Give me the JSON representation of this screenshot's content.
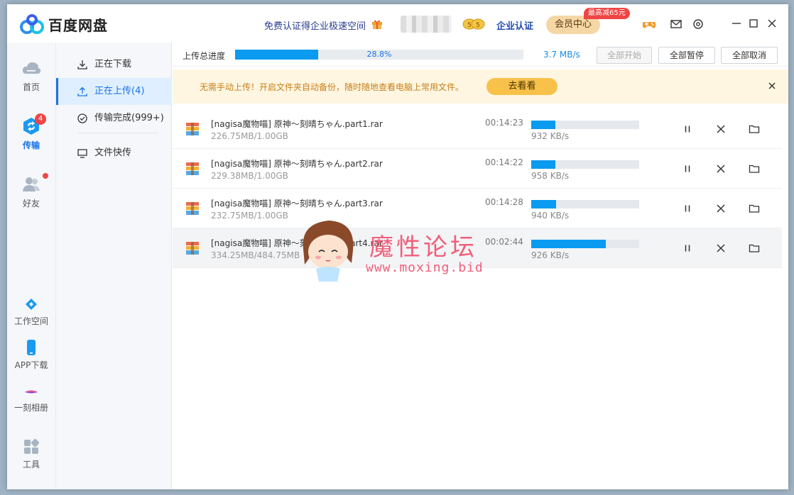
{
  "app": {
    "title": "百度网盘",
    "promo_text": "免费认证得企业极速空间",
    "enterprise_label": "企业认证",
    "vip_label": "会员中心",
    "vip_badge": "最高减65元",
    "coin_label": "5 5"
  },
  "leftnav": {
    "items": [
      {
        "label": "首页"
      },
      {
        "label": "传输",
        "badge": "4"
      },
      {
        "label": "好友"
      },
      {
        "label": "工作空间"
      },
      {
        "label": "APP下载"
      },
      {
        "label": "一刻相册"
      },
      {
        "label": "工具"
      }
    ]
  },
  "subnav": {
    "items": [
      {
        "label": "正在下载"
      },
      {
        "label": "正在上传(4)"
      },
      {
        "label": "传输完成(999+)"
      },
      {
        "label": "文件快传"
      }
    ]
  },
  "upload": {
    "total_label": "上传总进度",
    "total_percent_text": "28.8%",
    "total_progress": 0.288,
    "total_speed": "3.7 MB/s",
    "btn_start_all": "全部开始",
    "btn_pause_all": "全部暂停",
    "btn_cancel_all": "全部取消"
  },
  "banner": {
    "text": "无需手动上传！开启文件夹自动备份，随时随地查看电脑上常用文件。",
    "button": "去看看"
  },
  "files": [
    {
      "name": "[nagisa魔物喵] 原神～刻晴ちゃん.part1.rar",
      "size": "226.75MB/1.00GB",
      "time": "00:14:23",
      "speed": "932 KB/s",
      "progress": 0.2214
    },
    {
      "name": "[nagisa魔物喵] 原神～刻晴ちゃん.part2.rar",
      "size": "229.38MB/1.00GB",
      "time": "00:14:22",
      "speed": "958 KB/s",
      "progress": 0.224
    },
    {
      "name": "[nagisa魔物喵] 原神～刻晴ちゃん.part3.rar",
      "size": "232.75MB/1.00GB",
      "time": "00:14:28",
      "speed": "940 KB/s",
      "progress": 0.2273
    },
    {
      "name": "[nagisa魔物喵] 原神～刻晴ちゃん.part4.rar",
      "size": "334.25MB/484.75MB",
      "time": "00:02:44",
      "speed": "926 KB/s",
      "progress": 0.6895
    }
  ],
  "watermark": {
    "title": "魔性论坛",
    "url": "www.moxing.bid"
  },
  "colors": {
    "accent": "#1a73e8",
    "progress": "#0a9af0",
    "banner_bg": "#fff6e1",
    "badge_red": "#f04545"
  }
}
